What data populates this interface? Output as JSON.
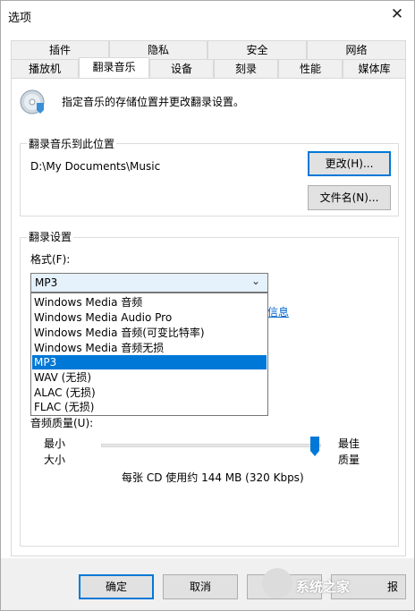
{
  "window": {
    "title": "选项"
  },
  "tabs_row1": [
    "插件",
    "隐私",
    "安全",
    "网络"
  ],
  "tabs_row2": [
    "播放机",
    "翻录音乐",
    "设备",
    "刻录",
    "性能",
    "媒体库"
  ],
  "header_desc": "指定音乐的存储位置并更改翻录设置。",
  "location": {
    "group_label": "翻录音乐到此位置",
    "path": "D:\\My Documents\\Music",
    "change_button": "更改(H)...",
    "filename_button": "文件名(N)..."
  },
  "rip_settings": {
    "group_label": "翻录设置",
    "format_label": "格式(F):",
    "format_selected": "MP3",
    "format_options": [
      "Windows Media 音频",
      "Windows Media Audio Pro",
      "Windows Media 音频(可变比特率)",
      "Windows Media 音频无损",
      "MP3",
      "WAV (无损)",
      "ALAC (无损)",
      "FLAC (无损)"
    ],
    "link_partial": "信息",
    "quality_label": "音频质量(U):",
    "quality_min_top": "最小",
    "quality_min_bottom": "大小",
    "quality_max_top": "最佳",
    "quality_max_bottom": "质量",
    "quality_level_fraction": 1.0,
    "quality_info": "每张 CD 使用约 144 MB (320 Kbps)"
  },
  "footer": {
    "ok": "确定",
    "cancel": "取消",
    "apply_partial": "",
    "help_partial": "报"
  },
  "watermark": {
    "text": "系统之家"
  }
}
